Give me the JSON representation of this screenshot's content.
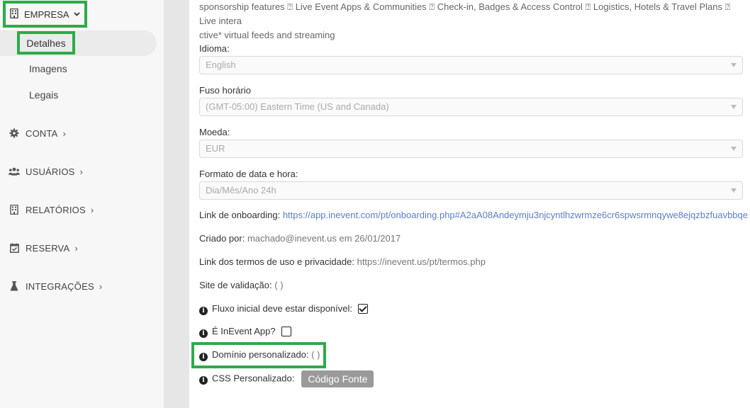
{
  "sidebar": {
    "section": {
      "label": "EMPRESA",
      "icon": "building-icon"
    },
    "subitems": [
      {
        "label": "Detalhes",
        "active": true
      },
      {
        "label": "Imagens"
      },
      {
        "label": "Legais"
      }
    ],
    "menu": [
      {
        "label": "CONTA",
        "icon": "gear-icon"
      },
      {
        "label": "USUÁRIOS",
        "icon": "users-icon"
      },
      {
        "label": "RELATÓRIOS",
        "icon": "building-icon"
      },
      {
        "label": "RESERVA",
        "icon": "calendar-check-icon"
      },
      {
        "label": "INTEGRAÇÕES",
        "icon": "flask-icon"
      }
    ]
  },
  "main": {
    "description": {
      "line1": "sponsorship features ⍰ Live Event Apps & Communities ⍰ Check-in, Badges & Access Control ⍰ Logistics, Hotels & Travel Plans ⍰ Live intera",
      "line2": "ctive* virtual feeds and streaming"
    },
    "language": {
      "label": "Idioma:",
      "value": "English"
    },
    "timezone": {
      "label": "Fuso horário",
      "value": "(GMT-05:00) Eastern Time (US and Canada)"
    },
    "currency": {
      "label": "Moeda:",
      "value": "EUR"
    },
    "datetime_format": {
      "label": "Formato de data e hora:",
      "value": "Dia/Mês/Ano 24h"
    },
    "onboarding": {
      "label": "Link de onboarding:",
      "value": "https://app.inevent.com/pt/onboarding.php#A2aA08Andeymju3njcyntlhzwrmze6cr6spwsrmnqywe8ejqzbzfuavbbqe"
    },
    "created_by": {
      "label": "Criado por:",
      "value": "machado@inevent.us em 26/01/2017"
    },
    "terms_link": {
      "label": "Link dos termos de uso e privacidade:",
      "value": "https://inevent.us/pt/termos.php"
    },
    "validation_site": {
      "label": "Site de validação:",
      "value": "( )"
    },
    "initial_flow": {
      "label": "Fluxo inicial deve estar disponível:",
      "checked": true
    },
    "is_inevent_app": {
      "label": "É InEvent App?",
      "checked": false
    },
    "custom_domain": {
      "label": "Domínio personalizado:",
      "value": "( )"
    },
    "custom_css": {
      "label": "CSS Personalizado:",
      "button": "Código Fonte"
    }
  },
  "colors": {
    "highlight": "#2eaa4a",
    "link": "#5b7fc7",
    "button": "#9a9a9a"
  }
}
